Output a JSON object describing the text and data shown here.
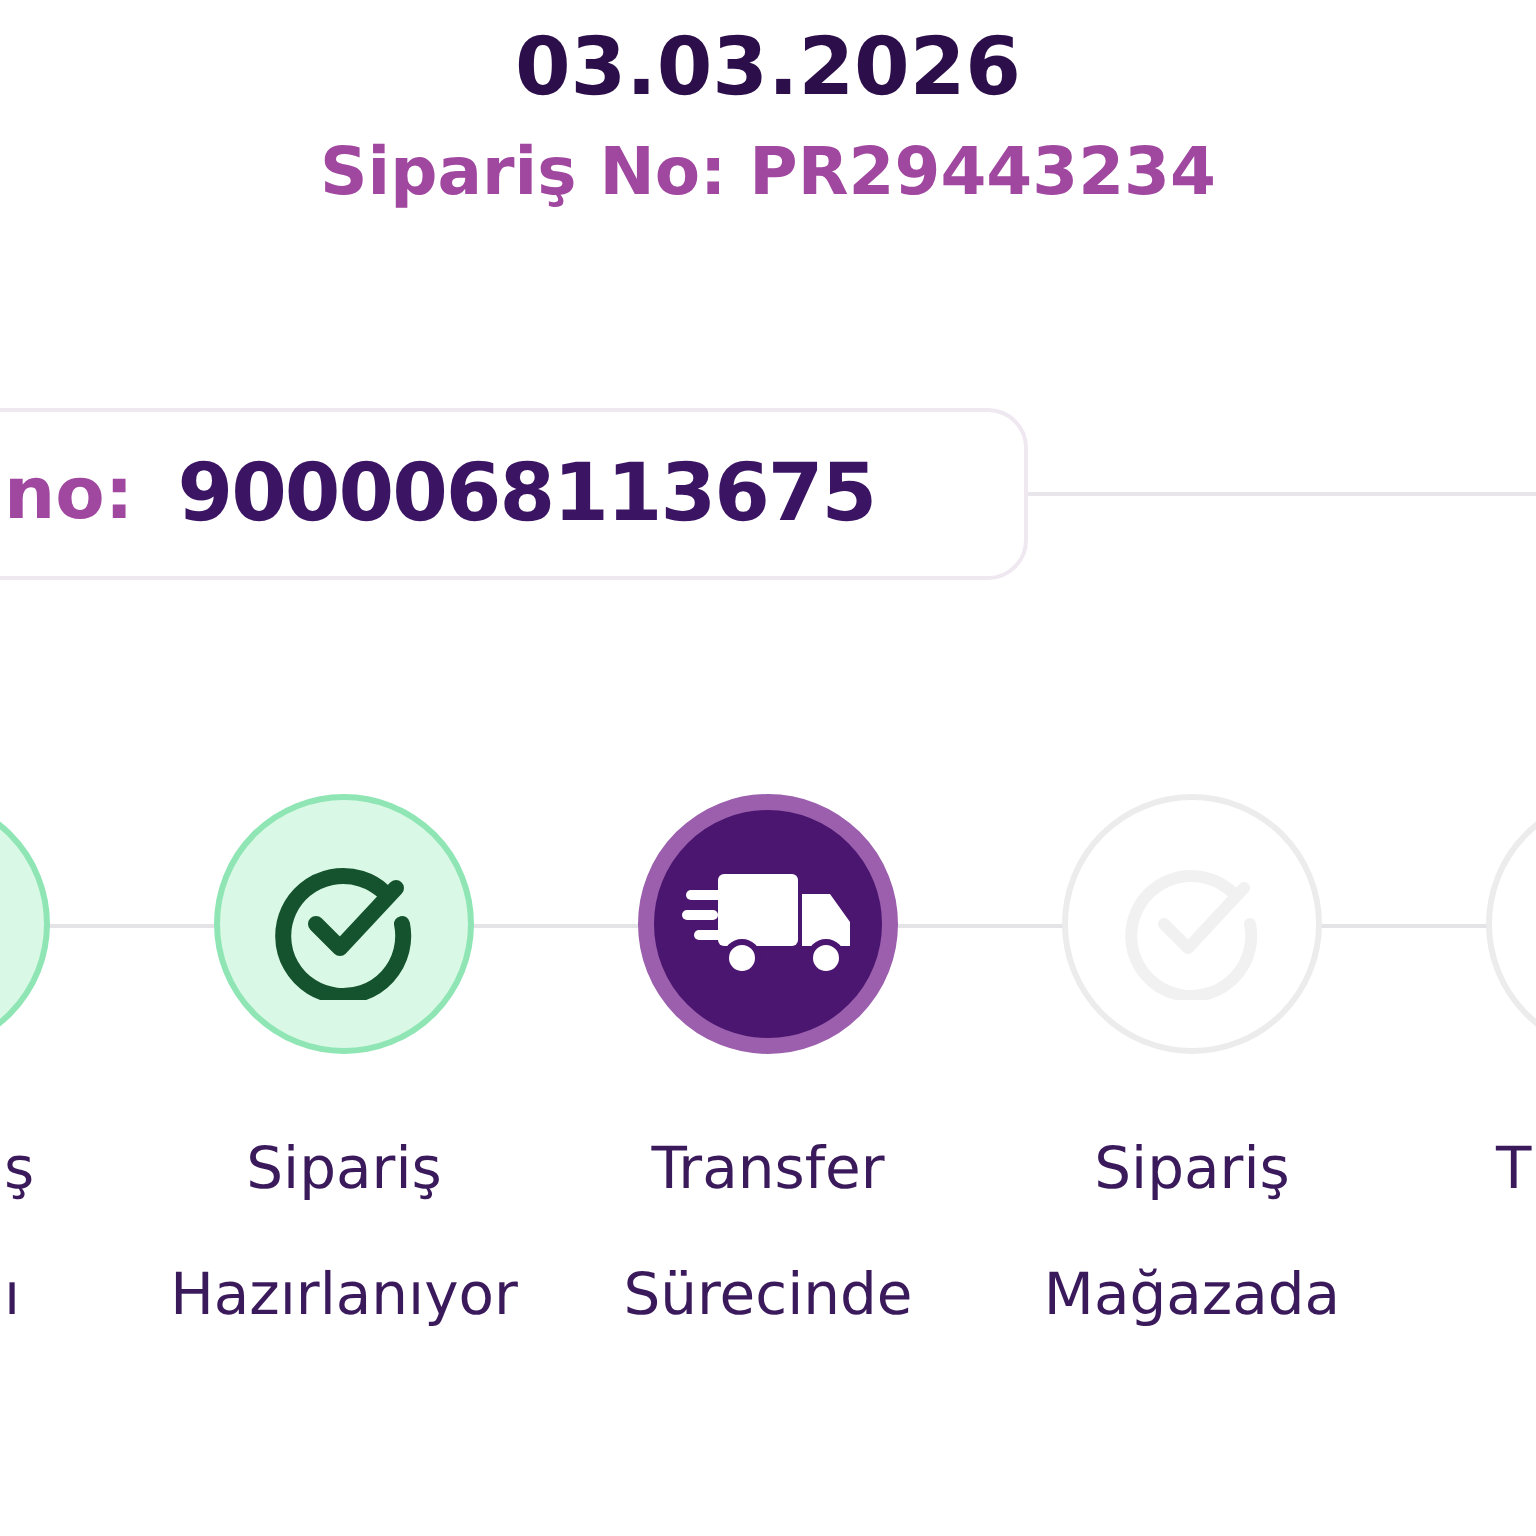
{
  "header": {
    "date": "03.03.2026",
    "order_no": "Sipariş No: PR29443234"
  },
  "tracking": {
    "label": "no:",
    "value": "9000068113675"
  },
  "steps": [
    {
      "kind": "done",
      "line1": "ş",
      "line2": "ı"
    },
    {
      "kind": "done",
      "line1": "Sipariş",
      "line2": "Hazırlanıyor"
    },
    {
      "kind": "current",
      "line1": "Transfer",
      "line2": "Sürecinde"
    },
    {
      "kind": "pending",
      "line1": "Sipariş",
      "line2": "Mağazada"
    },
    {
      "kind": "pending",
      "line1": "T"
    }
  ]
}
